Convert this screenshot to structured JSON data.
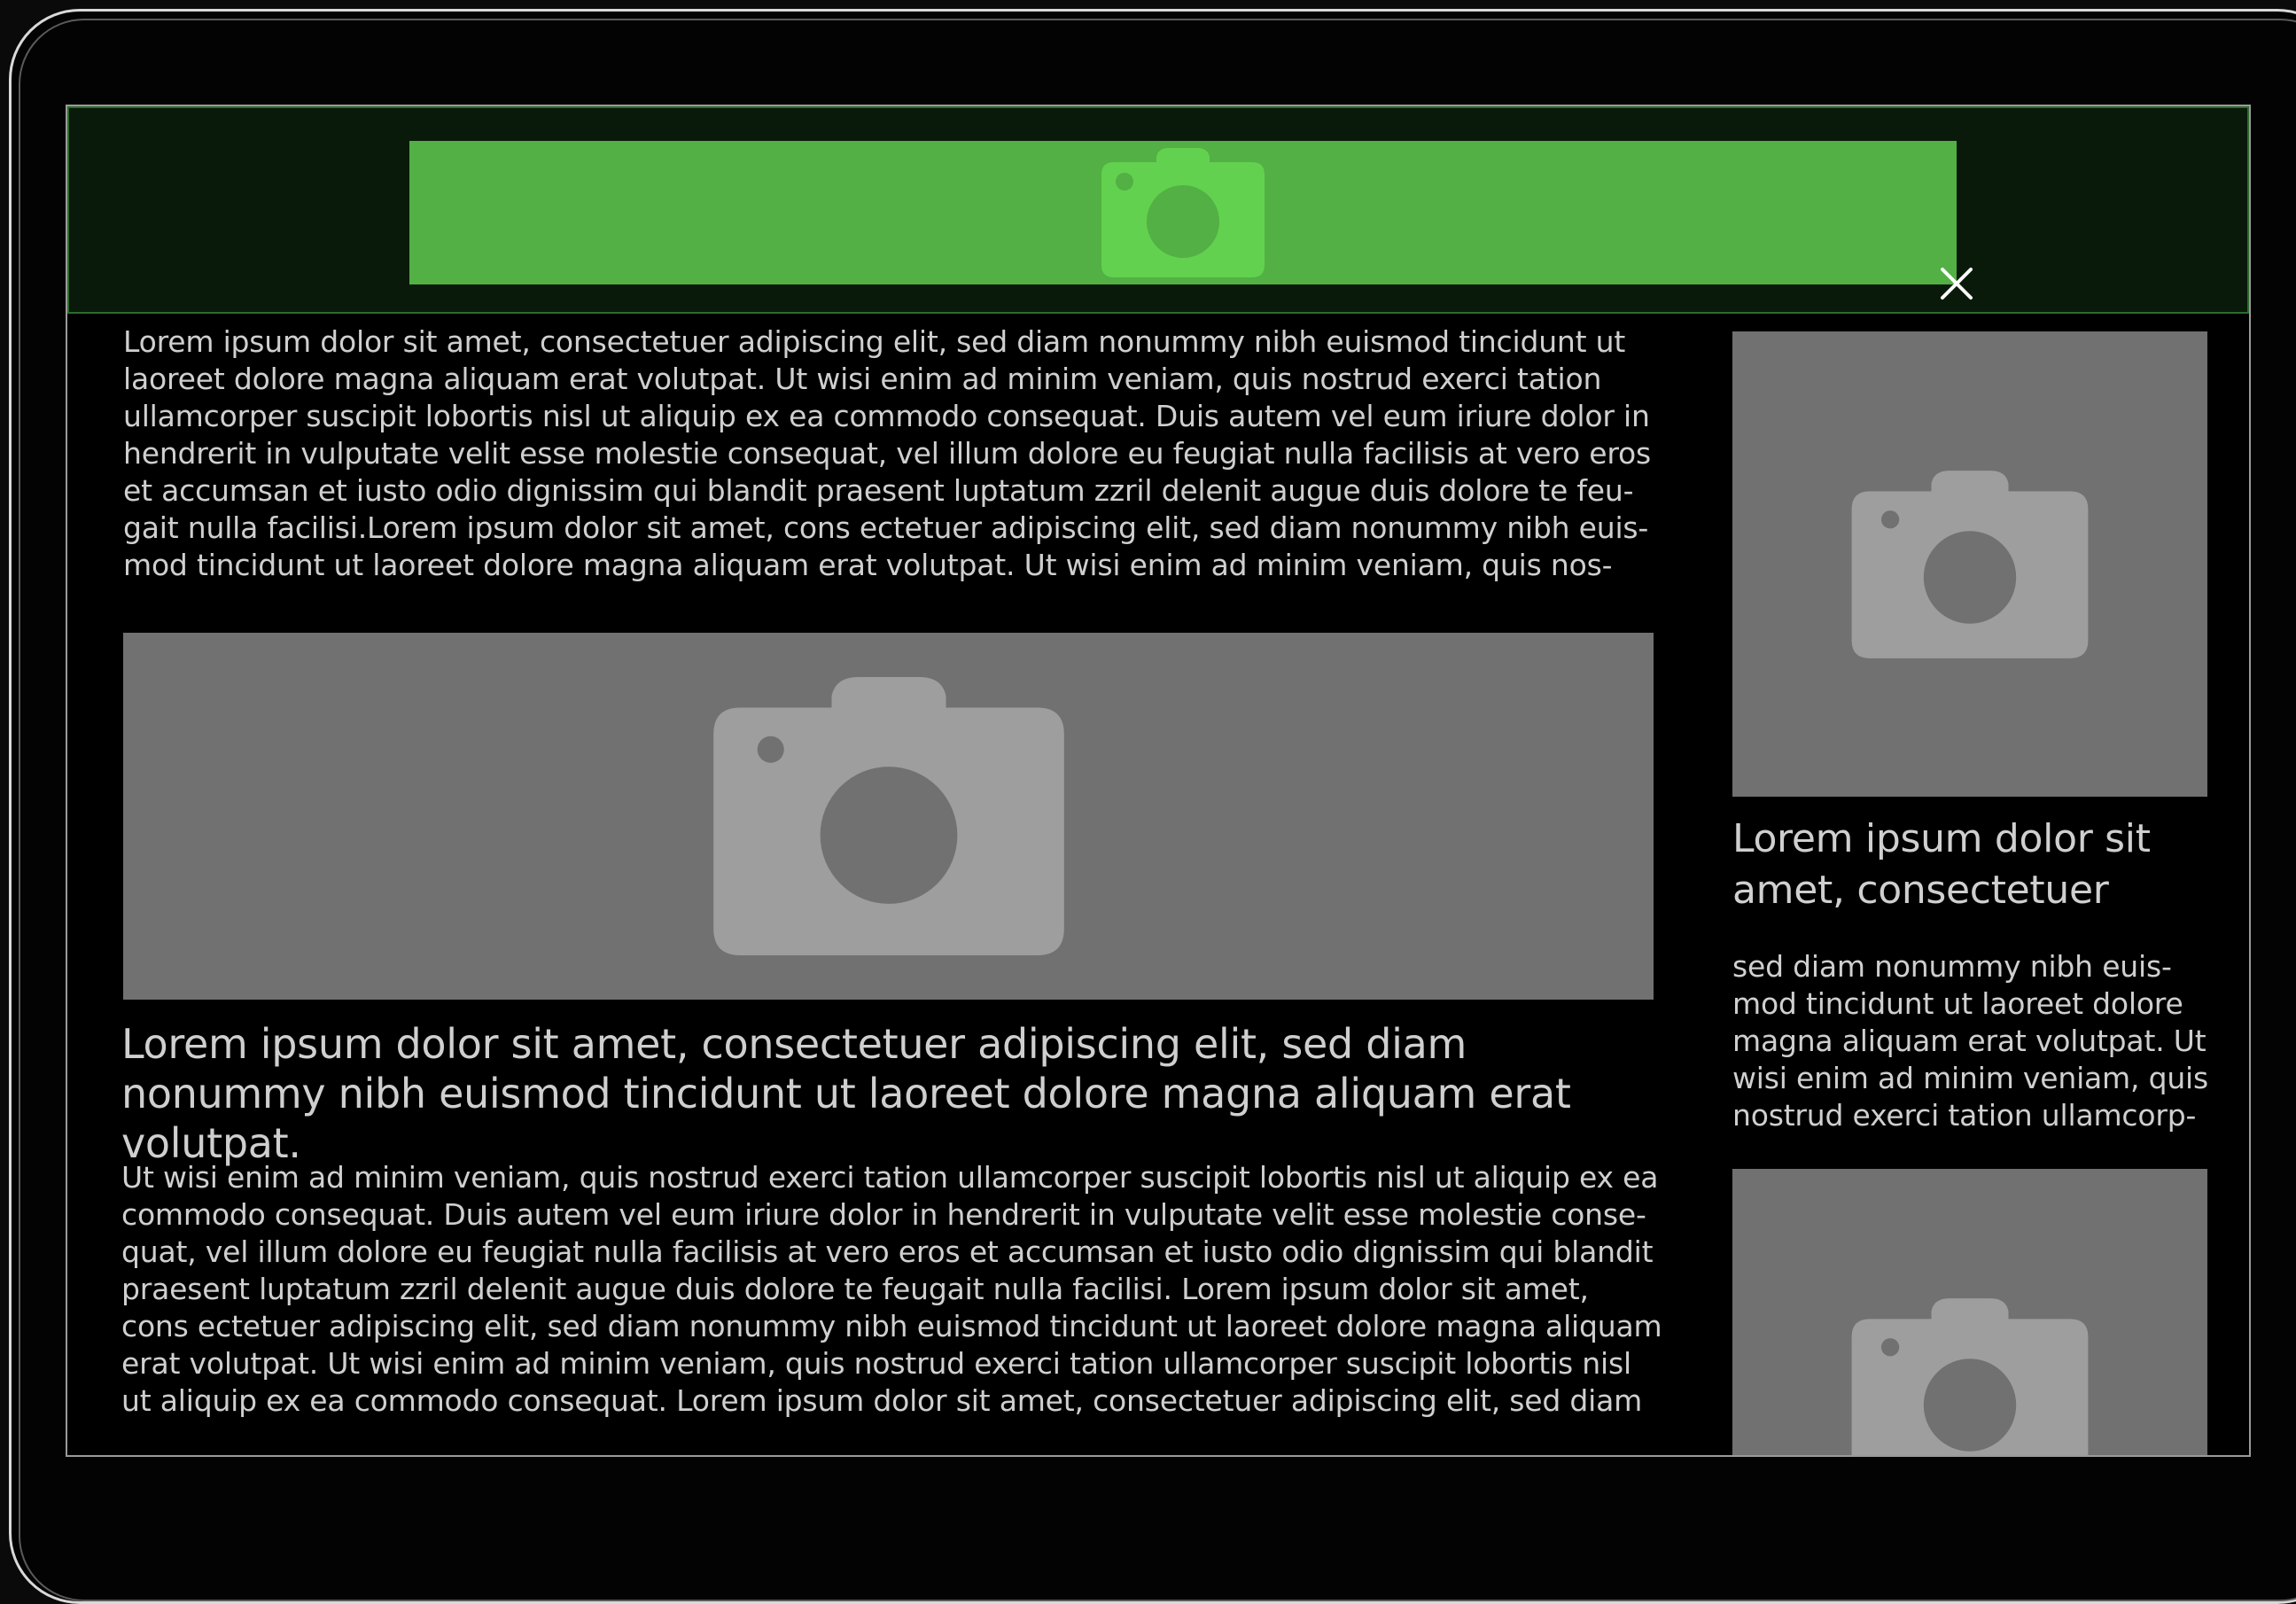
{
  "banner": {
    "ad_icon": "camera-icon",
    "close_icon": "close-icon",
    "accent_color": "#52b044"
  },
  "main": {
    "intro": "Lorem ipsum dolor sit amet, consectetuer adipiscing elit, sed diam nonummy nibh euismod tincidunt ut laoreet dolore magna aliquam erat volutpat. Ut wisi enim ad minim veniam, quis nostrud exerci tation ullamcorper suscipit lobortis nisl ut aliquip ex ea commodo consequat. Duis autem vel eum iriure dolor in hendrerit in vulputate velit esse molestie consequat, vel illum dolore eu feugiat nulla facilisis at vero eros et accumsan et iusto odio dignissim qui blandit praesent luptatum zzril delenit augue duis dolore te feu-gait nulla facilisi.Lorem ipsum dolor sit amet, cons ectetuer adipiscing elit, sed diam nonummy nibh euis-mod tincidunt ut laoreet dolore magna aliquam erat volutpat. Ut wisi enim ad minim veniam, quis nos-",
    "image_icon": "camera-icon",
    "headline": "Lorem ipsum dolor sit amet, consectetuer adipiscing elit, sed diam nonummy nibh euismod tincidunt ut laoreet dolore magna aliquam erat volutpat.",
    "body": "Ut wisi enim ad minim veniam, quis nostrud exerci tation ullamcorper suscipit lobortis nisl ut aliquip ex ea commodo consequat. Duis autem vel eum iriure dolor in hendrerit in vulputate velit esse molestie conse-quat, vel illum dolore eu feugiat nulla facilisis at vero eros et accumsan et iusto odio dignissim qui blandit praesent luptatum zzril delenit augue duis dolore te feugait nulla facilisi. Lorem ipsum dolor sit amet, cons ectetuer adipiscing elit, sed diam nonummy nibh euismod tincidunt ut laoreet dolore magna aliquam erat volutpat. Ut wisi enim ad minim veniam, quis nostrud exerci tation ullamcorper suscipit lobortis nisl ut aliquip ex ea commodo consequat. Lorem ipsum dolor sit amet, consectetuer adipiscing elit, sed diam"
  },
  "sidebar": {
    "image_icon": "camera-icon",
    "headline": "Lorem ipsum dolor sit amet, consectetuer",
    "body": "sed diam nonummy nibh euis-mod tincidunt ut laoreet dolore magna aliquam erat volutpat. Ut wisi enim ad minim veniam, quis nostrud exerci tation ullamcorp-"
  }
}
